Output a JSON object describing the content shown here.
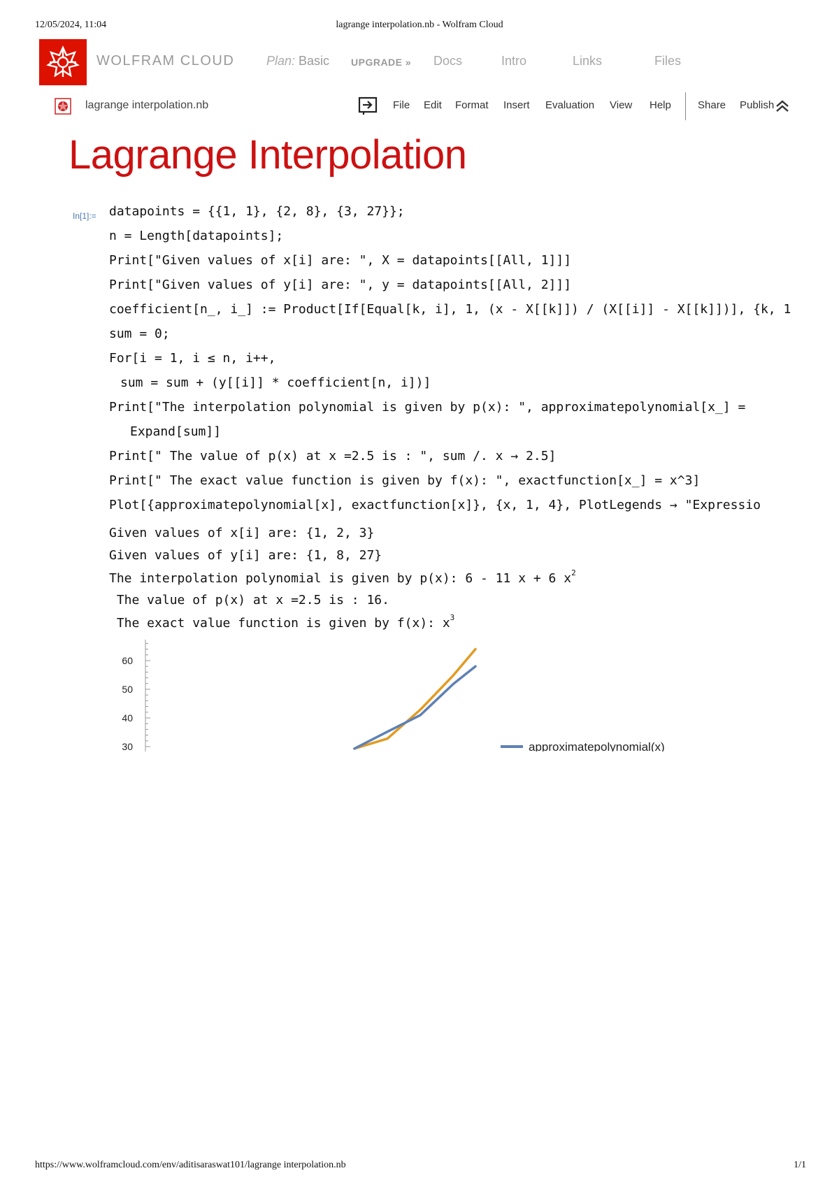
{
  "print_header": {
    "datetime": "12/05/2024, 11:04",
    "page_title": "lagrange interpolation.nb - Wolfram Cloud"
  },
  "print_footer": {
    "url": "https://www.wolframcloud.com/env/aditisaraswat101/lagrange interpolation.nb",
    "page": "1/1"
  },
  "topbar": {
    "brand": "WOLFRAM CLOUD",
    "plan_prefix": "Plan:",
    "plan_value": " Basic",
    "upgrade": "UPGRADE »",
    "nav": [
      "Docs",
      "Intro",
      "Links",
      "Files"
    ]
  },
  "notebook_bar": {
    "file_name": "lagrange interpolation.nb",
    "menus": [
      "File",
      "Edit",
      "Format",
      "Insert",
      "Evaluation",
      "View",
      "Help"
    ],
    "share": "Share",
    "publish": "Publish"
  },
  "title": "Lagrange Interpolation",
  "input_label": "In[1]:=",
  "code_lines": [
    "datapoints = {{1, 1}, {2, 8}, {3, 27}};",
    "n = Length[datapoints];",
    "Print[\"Given values of x[i] are: \", X = datapoints[[All, 1]]]",
    "Print[\"Given values of y[i] are: \", y = datapoints[[All, 2]]]",
    "coefficient[n_, i_] := Product[If[Equal[k, i], 1, (x - X[[k]]) / (X[[i]] - X[[k]])], {k, 1",
    "sum = 0;",
    "For[i = 1, i ≤ n, i++,",
    "sum = sum + (y[[i]] * coefficient[n, i])]",
    "Print[\"The interpolation polynomial is given by p(x): \", approximatepolynomial[x_] =",
    "Expand[sum]]",
    "Print[\" The value of p(x) at x =2.5 is : \", sum /. x → 2.5]",
    "Print[\" The exact value function is given by f(x): \", exactfunction[x_] = x^3]",
    "Plot[{approximatepolynomial[x], exactfunction[x]}, {x, 1, 4}, PlotLegends → \"Expressio"
  ],
  "outputs": {
    "line1": "Given values of x[i] are: {1, 2, 3}",
    "line2": "Given values of y[i] are: {1, 8, 27}",
    "line3_text": "The interpolation polynomial is given by p(x): 6 - 11 x + 6 x",
    "line3_sup": "2",
    "line4": " The value of p(x) at x =2.5 is : 16.",
    "line5_text": " The exact value function is given by f(x): x",
    "line5_sup": "3"
  },
  "chart_data": {
    "type": "line",
    "x_range": [
      1,
      4
    ],
    "ylim": [
      30,
      65
    ],
    "yticks": [
      30,
      40,
      50,
      60
    ],
    "ytick_labels": [
      "30",
      "40",
      "50",
      "60"
    ],
    "series": [
      {
        "name": "approximatepolynomial(x)",
        "color": "#5e81b5",
        "x": [
          2.9,
          3.2,
          3.5,
          3.8,
          4.0
        ],
        "y": [
          29.3,
          35.2,
          41.0,
          51.9,
          58.0
        ]
      },
      {
        "color": "#e19c24",
        "x": [
          2.9,
          3.2,
          3.5,
          3.8,
          4.0
        ],
        "y": [
          29.3,
          32.8,
          42.9,
          54.9,
          64.0
        ]
      }
    ],
    "legend_position": "right"
  },
  "colors": {
    "wolfram_red": "#dd1100",
    "title_red": "#cc1111",
    "approx_series": "#5e81b5",
    "exact_series": "#e19c24"
  }
}
